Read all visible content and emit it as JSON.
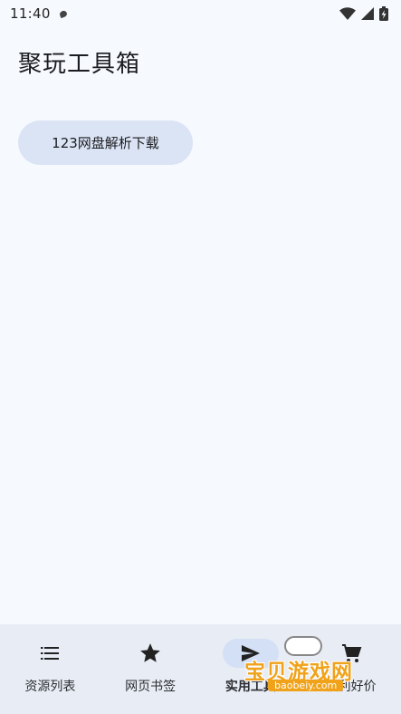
{
  "status": {
    "time": "11:40",
    "icons": [
      "notification-icon",
      "wifi-icon",
      "signal-icon",
      "battery-charging-icon"
    ]
  },
  "page": {
    "title": "聚玩工具箱"
  },
  "tools": {
    "items": [
      {
        "label": "123网盘解析下载"
      }
    ]
  },
  "nav": {
    "items": [
      {
        "label": "资源列表",
        "icon": "list-icon",
        "active": false
      },
      {
        "label": "网页书签",
        "icon": "star-icon",
        "active": false
      },
      {
        "label": "实用工具",
        "icon": "send-icon",
        "active": true
      },
      {
        "label": "福利好价",
        "icon": "cart-icon",
        "active": false
      }
    ]
  },
  "watermark": {
    "text": "宝贝游戏网",
    "url": "baobeiy.com"
  },
  "colors": {
    "background": "#f6f9fe",
    "chip": "#dbe4f5",
    "nav_bg": "#e8edf5",
    "nav_active": "#d3e0f6",
    "watermark": "#f0a21a"
  }
}
